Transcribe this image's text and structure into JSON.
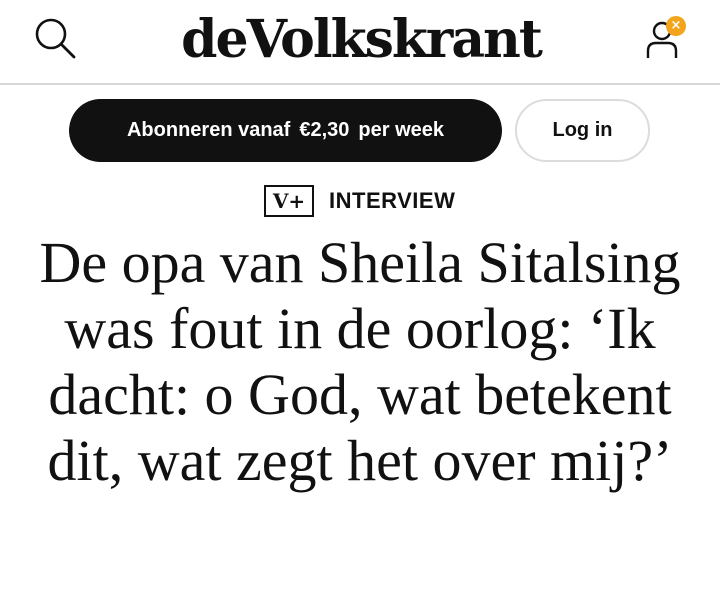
{
  "header": {
    "logo_text": "deVolkskrant",
    "search_icon": "search-icon",
    "account_icon": "user-icon",
    "account_badge": "×",
    "account_badge_color": "#f2a51a"
  },
  "subscribe": {
    "label_part1": "Abonneren vanaf",
    "price": "€2,30",
    "label_part2": "per week"
  },
  "login": {
    "label": "Log in"
  },
  "article": {
    "premium_badge": "V+",
    "kicker": "INTERVIEW",
    "headline": "De opa van Sheila Sitalsing was fout in de oorlog: ‘Ik dacht: o God, wat betekent dit, wat zegt het over mij?’"
  }
}
